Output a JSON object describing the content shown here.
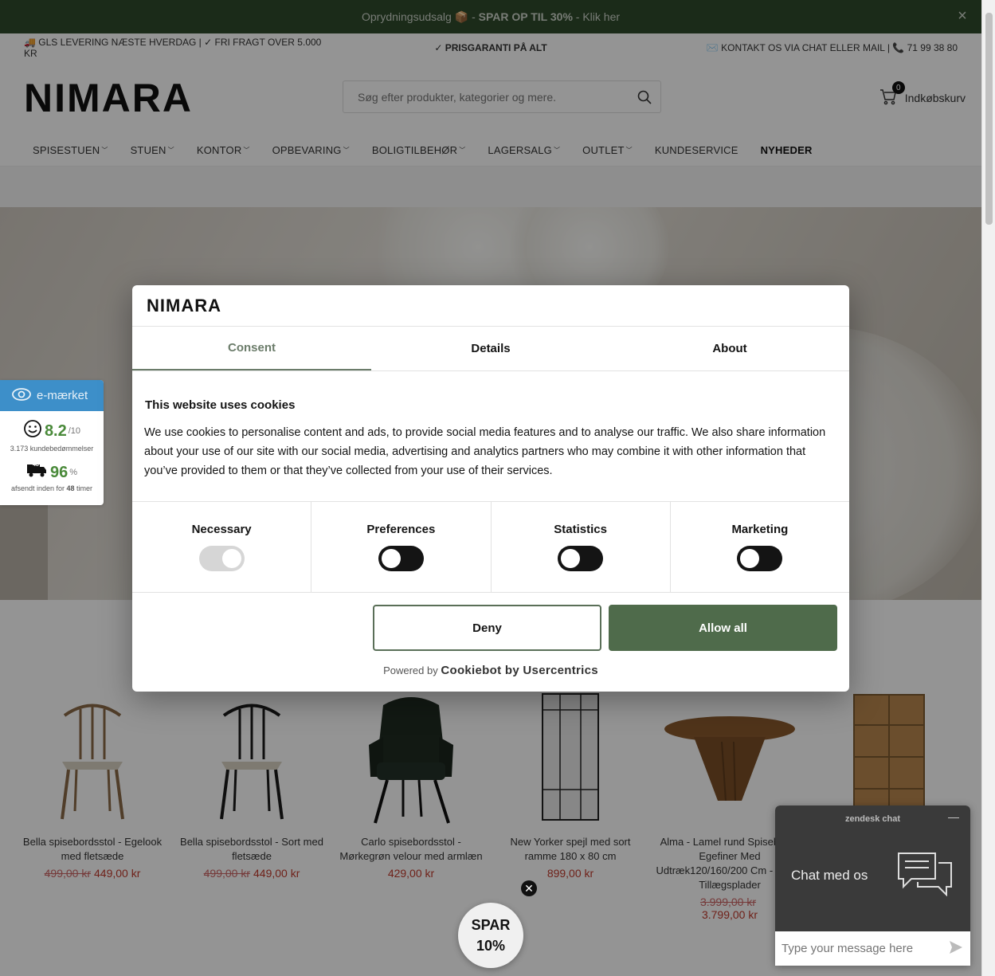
{
  "announcement": {
    "text_before": "Oprydningsudsalg",
    "emoji": "📦",
    "text_bold": "SPAR OP TIL 30%",
    "text_after": "- Klik her",
    "separator": "-"
  },
  "usp": {
    "left_icon": "🚚",
    "left": "GLS LEVERING NÆSTE HVERDAG | ✓ FRI FRAGT OVER 5.000 KR",
    "center": "✓ PRISGARANTI PÅ ALT",
    "right_icon": "✉️",
    "right": "KONTAKT OS VIA CHAT ELLER MAIL |",
    "phone_icon": "📞",
    "phone": "71 99 38 80"
  },
  "header": {
    "logo": "NIMARA",
    "search_placeholder": "Søg efter produkter, kategorier og mere.",
    "cart_count": "0",
    "cart_label": "Indkøbskurv"
  },
  "nav": [
    {
      "label": "SPISESTUEN",
      "dropdown": true
    },
    {
      "label": "STUEN",
      "dropdown": true
    },
    {
      "label": "KONTOR",
      "dropdown": true
    },
    {
      "label": "OPBEVARING",
      "dropdown": true
    },
    {
      "label": "BOLIGTILBEHØR",
      "dropdown": true
    },
    {
      "label": "LAGERSALG",
      "dropdown": true
    },
    {
      "label": "OUTLET",
      "dropdown": true
    },
    {
      "label": "KUNDESERVICE",
      "dropdown": false
    },
    {
      "label": "NYHEDER",
      "dropdown": false
    }
  ],
  "trust": {
    "brand": "e-mærket",
    "rating": "8.2",
    "rating_max": "/10",
    "reviews": "3.173 kundebedømmelser",
    "percent": "96",
    "percent_sign": "%",
    "shipped_text": "afsendt inden for",
    "shipped_hours": "48",
    "shipped_unit": "timer",
    "truck_badge": "48"
  },
  "cookie": {
    "logo": "NIMARA",
    "tabs": [
      "Consent",
      "Details",
      "About"
    ],
    "heading": "This website uses cookies",
    "body": "We use cookies to personalise content and ads, to provide social media features and to analyse our traffic. We also share information about your use of our site with our social media, advertising and analytics partners who may combine it with other information that you’ve provided to them or that they’ve collected from your use of their services.",
    "toggles": [
      "Necessary",
      "Preferences",
      "Statistics",
      "Marketing"
    ],
    "deny": "Deny",
    "allow": "Allow all",
    "powered_by": "Powered by",
    "powered_brand": "Cookiebot by Usercentrics"
  },
  "products": [
    {
      "name": "Bella spisebordsstol - Egelook med fletsæde",
      "old_price": "499,00 kr",
      "price": "449,00 kr"
    },
    {
      "name": "Bella spisebordsstol - Sort med fletsæde",
      "old_price": "499,00 kr",
      "price": "449,00 kr"
    },
    {
      "name": "Carlo spisebordsstol - Mørkegrøn velour med armlæn",
      "old_price": "",
      "price": "429,00 kr"
    },
    {
      "name": "New Yorker spejl med sort ramme 180 x 80 cm",
      "old_price": "",
      "price": "899,00 kr"
    },
    {
      "name": "Alma - Lamel rund Spisebord i Egefiner Med Udtræk120/160/200 Cm - Inkl. 2 Tillægsplader",
      "old_price": "3.999,00 kr",
      "price": "3.799,00 kr"
    },
    {
      "name": "",
      "old_price": "",
      "price": ""
    }
  ],
  "spar": {
    "line1": "SPAR",
    "line2": "10%",
    "close": "✕"
  },
  "chat": {
    "title": "zendesk chat",
    "minimize": "—",
    "body": "Chat med os",
    "input_placeholder": "Type your message here"
  },
  "colors": {
    "announce_bg": "#2f4a2c",
    "allow_btn": "#4f6b4b",
    "trust_blue": "#3d8fc9",
    "sale_red": "#c0392b"
  }
}
